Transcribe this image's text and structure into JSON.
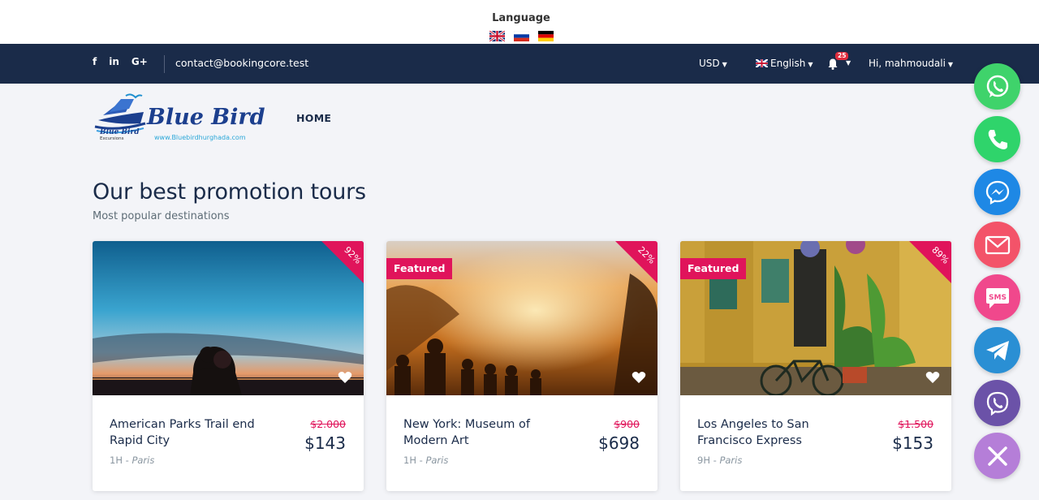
{
  "language": {
    "title": "Language",
    "flags": [
      "uk-flag-icon",
      "russia-flag-icon",
      "germany-flag-icon"
    ]
  },
  "topbar": {
    "social": [
      "f",
      "in",
      "G+"
    ],
    "email": "contact@bookingcore.test",
    "currency": "USD",
    "language": "English",
    "notifications_count": "25",
    "user": "Hi, mahmoudali"
  },
  "header": {
    "logo_text": "Blue Bird",
    "logo_sub": "Blue Bird",
    "logo_excursions": "Excursions",
    "logo_url": "www.Bluebirdhurghada.com",
    "nav": [
      "HOME"
    ]
  },
  "section": {
    "title": "Our best promotion tours",
    "subtitle": "Most popular destinations"
  },
  "tours": [
    {
      "name": "American Parks Trail end Rapid City",
      "old_price": "$2.000",
      "price": "$143",
      "duration": "1H",
      "location": "Paris",
      "discount": "92%",
      "featured": ""
    },
    {
      "name": "New York: Museum of Modern Art",
      "old_price": "$900",
      "price": "$698",
      "duration": "1H",
      "location": "Paris",
      "discount": "22%",
      "featured": "Featured"
    },
    {
      "name": "Los Angeles to San Francisco Express",
      "old_price": "$1.500",
      "price": "$153",
      "duration": "9H",
      "location": "Paris",
      "discount": "89%",
      "featured": "Featured"
    }
  ],
  "meta_sep": " - ",
  "contact_buttons": [
    {
      "name": "whatsapp",
      "color": "#3fd36b"
    },
    {
      "name": "phone",
      "color": "#2fd46b"
    },
    {
      "name": "messenger",
      "color": "#1e88e5"
    },
    {
      "name": "email",
      "color": "#f35369"
    },
    {
      "name": "sms",
      "color": "#f0488c"
    },
    {
      "name": "telegram",
      "color": "#2a8fd4"
    },
    {
      "name": "viber",
      "color": "#6b52a8"
    },
    {
      "name": "close",
      "color": "#b57ed8"
    }
  ],
  "colors": {
    "navy": "#1a2b49",
    "accent": "#e0145b"
  }
}
